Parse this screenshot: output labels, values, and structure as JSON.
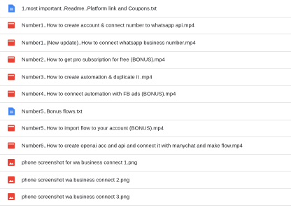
{
  "colors": {
    "doc_icon": "#4285f4",
    "video_icon": "#ea4335",
    "image_icon": "#ea4335",
    "text": "#202124",
    "divider": "#e6e6e6"
  },
  "files": [
    {
      "name": "1.most important..Readme..Platform link and Coupons.txt",
      "icon": "doc-icon"
    },
    {
      "name": "Number1..How to create account & connect number to whatsapp api.mp4",
      "icon": "video-icon"
    },
    {
      "name": "Number1..(New update)..How to connect whatsapp business number.mp4",
      "icon": "video-icon"
    },
    {
      "name": "Number2..How to get pro subscription for free (BONUS).mp4",
      "icon": "video-icon"
    },
    {
      "name": "Number3..How to create automation & duplicate it .mp4",
      "icon": "video-icon"
    },
    {
      "name": "Number4..How to connect automation with FB ads (BONUS).mp4",
      "icon": "video-icon"
    },
    {
      "name": "Number5..Bonus flows.txt",
      "icon": "doc-icon"
    },
    {
      "name": "Number5..How to import flow to your account (BONUS).mp4",
      "icon": "video-icon"
    },
    {
      "name": "Number6..How to create openai acc and api and connect it with manychat and make flow.mp4",
      "icon": "video-icon"
    },
    {
      "name": "phone screenshot for wa business connect 1.png",
      "icon": "image-icon"
    },
    {
      "name": "phone screenshot wa business connect 2.png",
      "icon": "image-icon"
    },
    {
      "name": "phone screenshot wa business connect 3.png",
      "icon": "image-icon"
    }
  ]
}
